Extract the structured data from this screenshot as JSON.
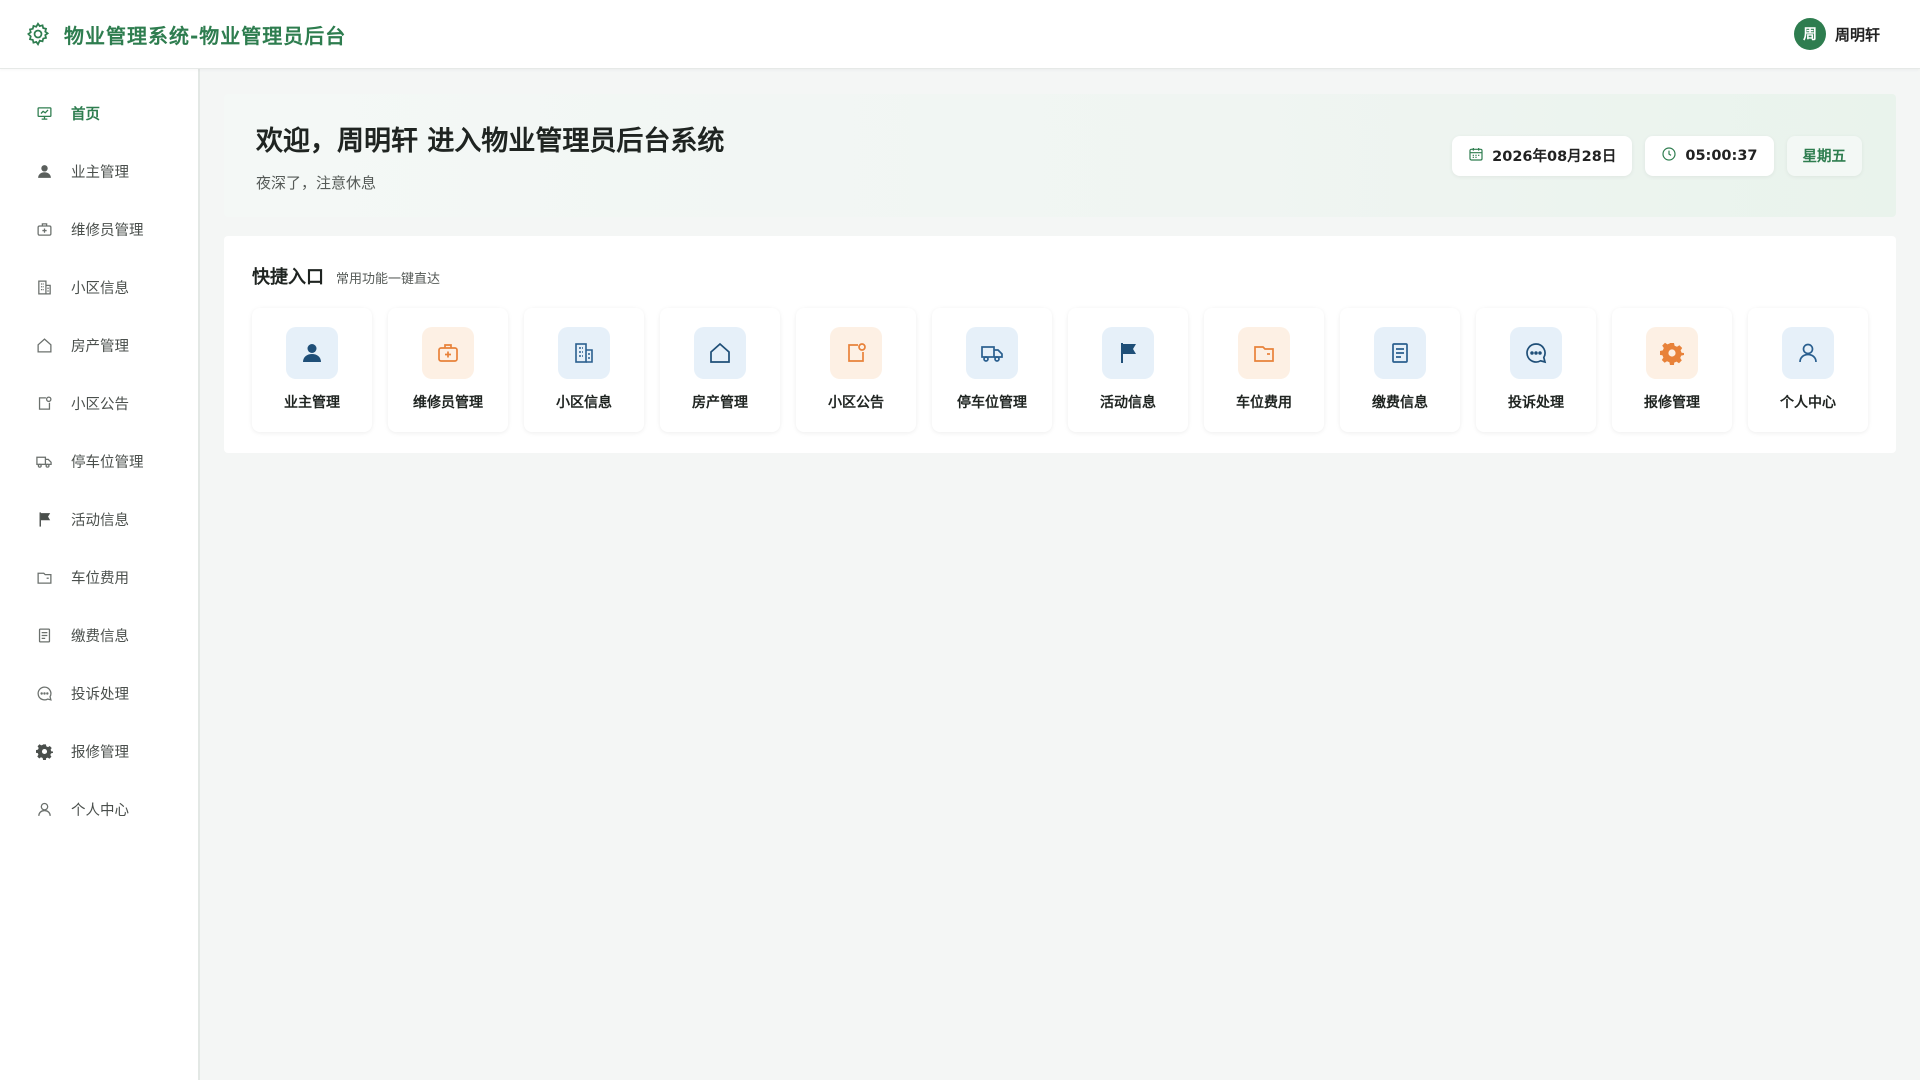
{
  "header": {
    "title": "物业管理系统-物业管理员后台",
    "user_avatar_text": "周",
    "user_name": "周明轩",
    "brand_icon": "gear-icon"
  },
  "sidebar": {
    "items": [
      {
        "label": "首页",
        "icon": "dashboard-icon",
        "active": true
      },
      {
        "label": "业主管理",
        "icon": "user-icon"
      },
      {
        "label": "维修员管理",
        "icon": "medkit-icon"
      },
      {
        "label": "小区信息",
        "icon": "building-icon"
      },
      {
        "label": "房产管理",
        "icon": "house-icon"
      },
      {
        "label": "小区公告",
        "icon": "notice-icon"
      },
      {
        "label": "停车位管理",
        "icon": "truck-icon"
      },
      {
        "label": "活动信息",
        "icon": "flag-icon"
      },
      {
        "label": "车位费用",
        "icon": "wallet-icon"
      },
      {
        "label": "缴费信息",
        "icon": "document-icon"
      },
      {
        "label": "投诉处理",
        "icon": "chat-icon"
      },
      {
        "label": "报修管理",
        "icon": "gear-icon"
      },
      {
        "label": "个人中心",
        "icon": "person-icon"
      }
    ]
  },
  "welcome": {
    "title": "欢迎，周明轩 进入物业管理员后台系统",
    "subtitle": "夜深了，注意休息",
    "date": "2026年08月28日",
    "time": "05:00:37",
    "weekday": "星期五"
  },
  "quick": {
    "title": "快捷入口",
    "subtitle": "常用功能一键直达",
    "items": [
      {
        "label": "业主管理",
        "icon": "user-icon",
        "tone": "blue"
      },
      {
        "label": "维修员管理",
        "icon": "medkit-icon",
        "tone": "orange"
      },
      {
        "label": "小区信息",
        "icon": "building-icon",
        "tone": "blue"
      },
      {
        "label": "房产管理",
        "icon": "house-icon",
        "tone": "blue"
      },
      {
        "label": "小区公告",
        "icon": "notice-icon",
        "tone": "orange"
      },
      {
        "label": "停车位管理",
        "icon": "truck-icon",
        "tone": "blue"
      },
      {
        "label": "活动信息",
        "icon": "flag-icon",
        "tone": "blue"
      },
      {
        "label": "车位费用",
        "icon": "wallet-icon",
        "tone": "orange"
      },
      {
        "label": "缴费信息",
        "icon": "document-icon",
        "tone": "blue"
      },
      {
        "label": "投诉处理",
        "icon": "chat-icon",
        "tone": "blue"
      },
      {
        "label": "报修管理",
        "icon": "gear-icon",
        "tone": "orange"
      },
      {
        "label": "个人中心",
        "icon": "person-icon",
        "tone": "blue"
      }
    ]
  },
  "colors": {
    "brand": "#2e7d4f",
    "icon_blue": "#2a5f8f",
    "icon_orange": "#e8823a",
    "sidebar_icon": "#6b706d"
  }
}
